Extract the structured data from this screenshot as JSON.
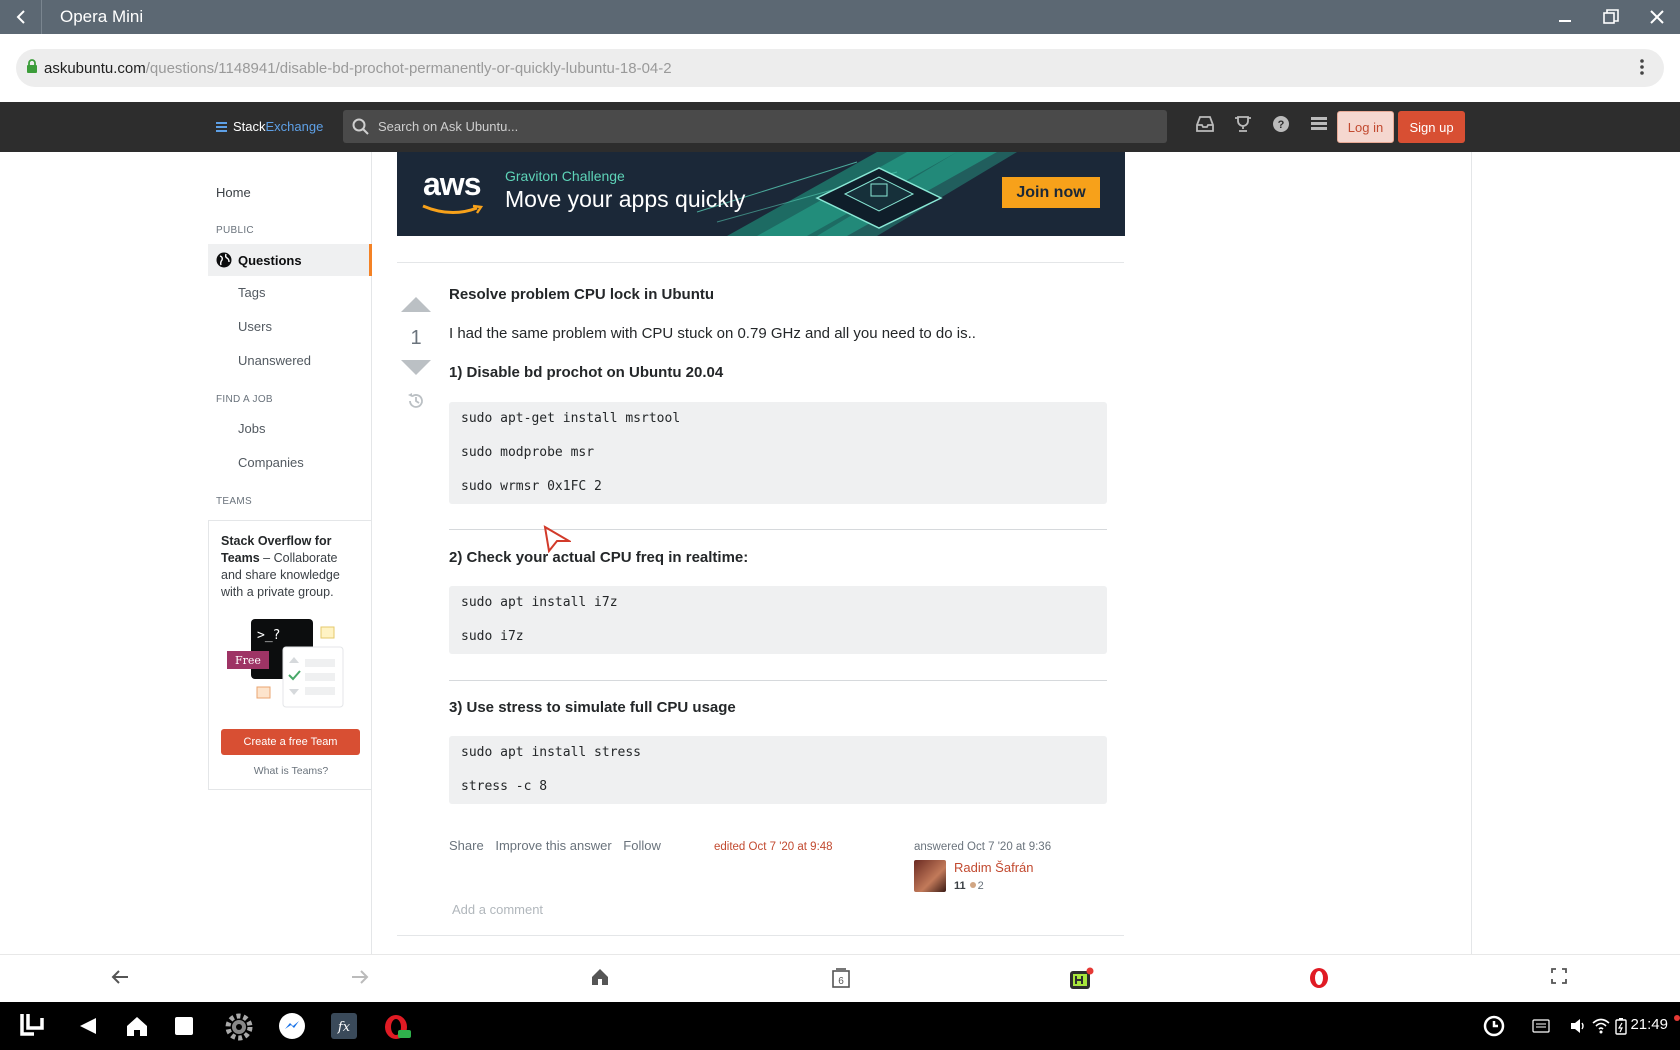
{
  "window": {
    "title": "Opera Mini"
  },
  "address": {
    "host": "askubuntu.com",
    "path": "/questions/1148941/disable-bd-prochot-permanently-or-quickly-lubuntu-18-04-2"
  },
  "header": {
    "logo_stack": "Stack",
    "logo_exchange": "Exchange",
    "search_placeholder": "Search on Ask Ubuntu...",
    "login": "Log in",
    "signup": "Sign up"
  },
  "sidebar": {
    "home": "Home",
    "public_label": "PUBLIC",
    "questions": "Questions",
    "tags": "Tags",
    "users": "Users",
    "unanswered": "Unanswered",
    "find_job_label": "FIND A JOB",
    "jobs": "Jobs",
    "companies": "Companies",
    "teams_label": "TEAMS",
    "teams_title": "Stack Overflow for Teams",
    "teams_desc": " – Collaborate and share knowledge with a private group.",
    "free_badge": "Free",
    "prompt_text": ">_?",
    "create_team": "Create a free Team",
    "what_is_teams": "What is Teams?"
  },
  "ad": {
    "brand": "aws",
    "kicker": "Graviton Challenge",
    "headline": "Move your apps quickly",
    "cta": "Join now"
  },
  "answer": {
    "votes": "1",
    "heading": "Resolve problem CPU lock in Ubuntu",
    "intro": "I had the same problem with CPU stuck on 0.79 GHz and all you need to do is..",
    "step1": "1) Disable bd prochot on Ubuntu 20.04",
    "code1": [
      "sudo apt-get install msrtool",
      "sudo modprobe msr",
      "sudo wrmsr 0x1FC 2"
    ],
    "step2": "2) Check your actual CPU freq in realtime:",
    "code2": [
      "sudo apt install i7z",
      "sudo i7z"
    ],
    "step3": "3) Use stress to simulate full CPU usage",
    "code3": [
      "sudo apt install stress",
      "stress -c 8"
    ],
    "share": "Share",
    "improve": "Improve this answer",
    "follow": "Follow",
    "edited": "edited Oct 7 '20 at 9:48",
    "answered": "answered Oct 7 '20 at 9:36",
    "user_name": "Radim Šafrán",
    "user_rep": "11",
    "user_bronze": "2",
    "add_comment": "Add a comment"
  },
  "opera_bar": {
    "tabs_count": "6"
  },
  "taskbar": {
    "clock": "21:49"
  },
  "colors": {
    "accent": "#d84f33",
    "header_bg": "#2d2d2d",
    "title_bar": "#5c6873"
  }
}
